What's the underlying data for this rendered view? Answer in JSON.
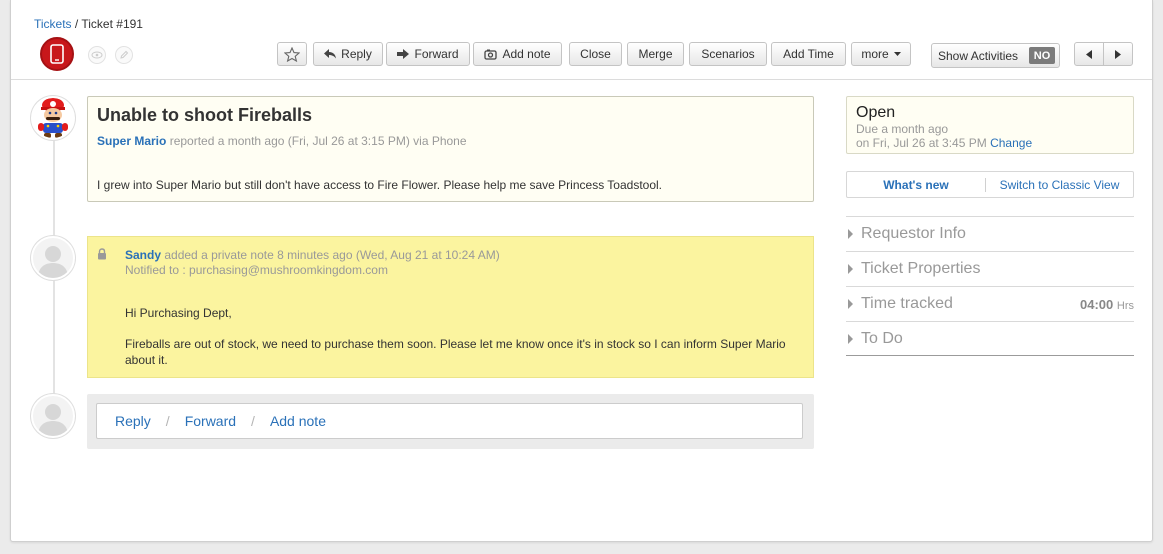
{
  "breadcrumb": {
    "root": "Tickets",
    "separator": "/",
    "current": "Ticket #191"
  },
  "toolbar": {
    "reply": "Reply",
    "forward": "Forward",
    "add_note": "Add note",
    "close": "Close",
    "merge": "Merge",
    "scenarios": "Scenarios",
    "add_time": "Add Time",
    "more": "more",
    "show_activities": "Show Activities",
    "toggle_state": "NO"
  },
  "ticket": {
    "title": "Unable to shoot Fireballs",
    "requester": "Super Mario",
    "reported_meta": "reported a month ago (Fri, Jul 26 at 3:15 PM) via Phone",
    "body": "I grew into Super Mario but still don't have access to Fire Flower. Please help me save Princess Toadstool."
  },
  "note": {
    "author": "Sandy",
    "meta": "added a private note 8 minutes ago (Wed, Aug 21 at 10:24 AM)",
    "notified": "Notified to : purchasing@mushroomkingdom.com",
    "greeting": "Hi Purchasing Dept,",
    "message": "Fireballs are out of stock, we need to purchase them soon. Please let me know once it's in stock so I can inform Super Mario about it."
  },
  "reply_actions": {
    "reply": "Reply",
    "forward": "Forward",
    "add_note": "Add note",
    "sep": "/"
  },
  "status": {
    "state": "Open",
    "due": "Due a month ago",
    "due_on": "on Fri, Jul 26 at 3:45 PM",
    "change": "Change"
  },
  "view_switch": {
    "whats_new": "What's new",
    "classic": "Switch to Classic View"
  },
  "sidebar": {
    "requestor_info": "Requestor Info",
    "ticket_properties": "Ticket Properties",
    "time_tracked": "Time tracked",
    "time_value": "04:00",
    "time_unit": "Hrs",
    "todo": "To Do"
  },
  "colors": {
    "link": "#2a71b8",
    "note_bg": "#fbf49f",
    "ticket_bg": "#fffef3",
    "source_icon": "#c8171b"
  }
}
